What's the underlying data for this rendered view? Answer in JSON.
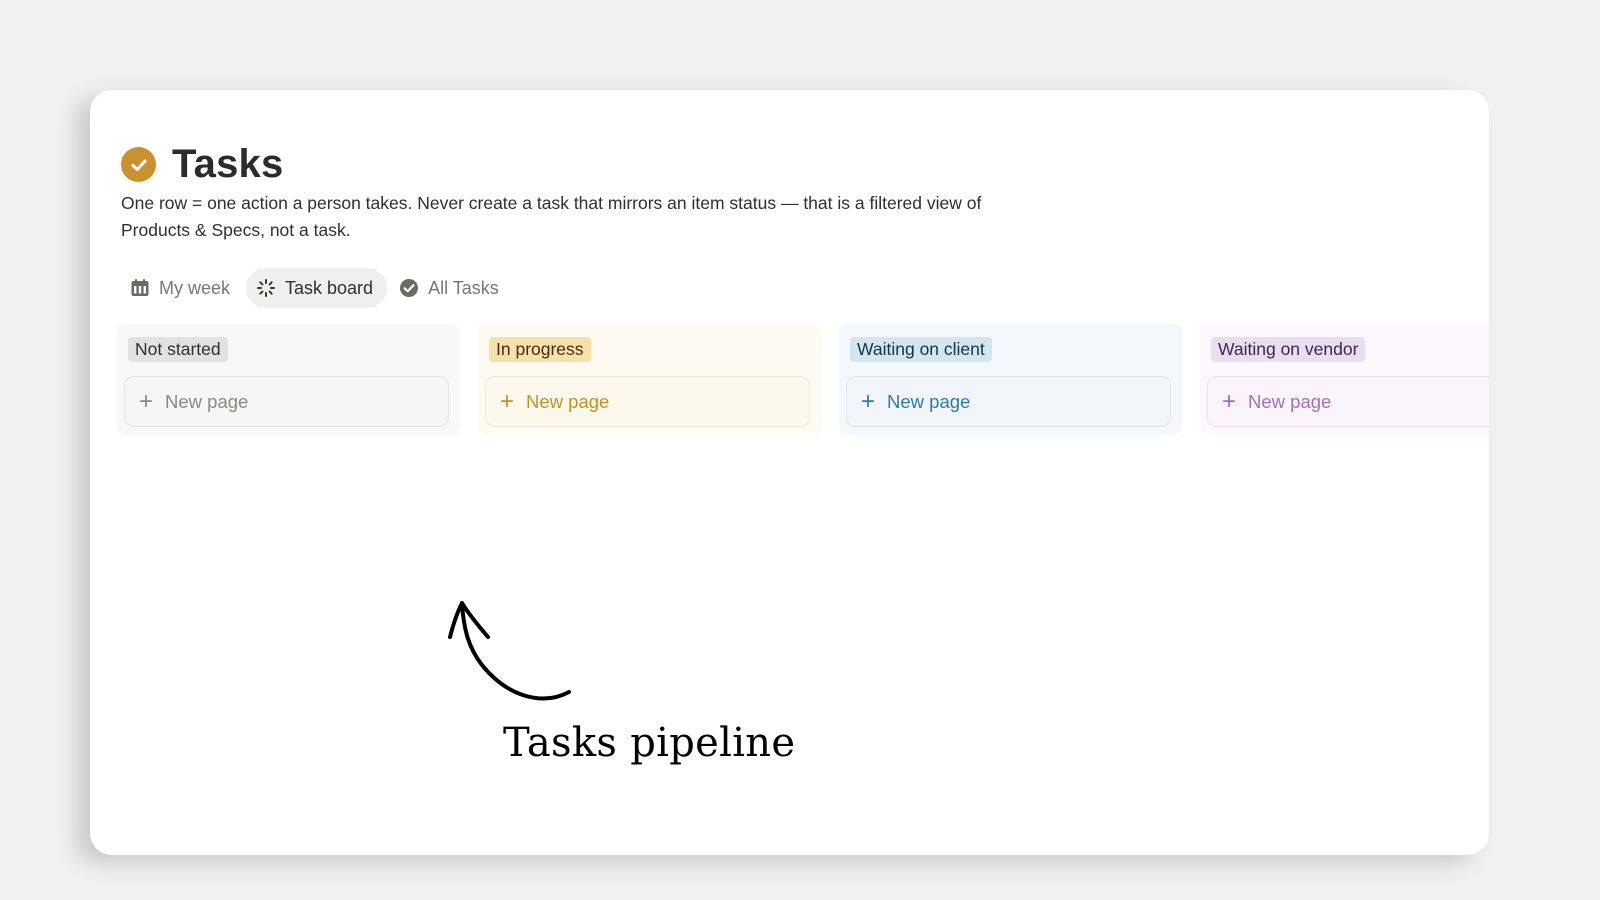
{
  "page": {
    "title": "Tasks",
    "title_icon": "check-circle-icon",
    "description": "One row = one action a person takes. Never create a task that mirrors an item status — that is a filtered view of Products & Specs, not a task."
  },
  "views": [
    {
      "label": "My week",
      "icon": "calendar-icon",
      "active": false
    },
    {
      "label": "Task board",
      "icon": "board-loader-icon",
      "active": true
    },
    {
      "label": "All Tasks",
      "icon": "check-circle-icon",
      "active": false
    }
  ],
  "board": {
    "columns": [
      {
        "label": "Not started",
        "new_label": "New page",
        "plus": "+",
        "color": "#e3e2e0"
      },
      {
        "label": "In progress",
        "new_label": "New page",
        "plus": "+",
        "color": "#f5e1ac"
      },
      {
        "label": "Waiting on client",
        "new_label": "New page",
        "plus": "+",
        "color": "#d3e5ef"
      },
      {
        "label": "Waiting on vendor",
        "new_label": "New page",
        "plus": "+",
        "color": "#e8deee"
      }
    ]
  },
  "annotation": {
    "text": "Tasks pipeline"
  },
  "colors": {
    "accent": "#cb912f",
    "background": "#f1f1f1"
  }
}
